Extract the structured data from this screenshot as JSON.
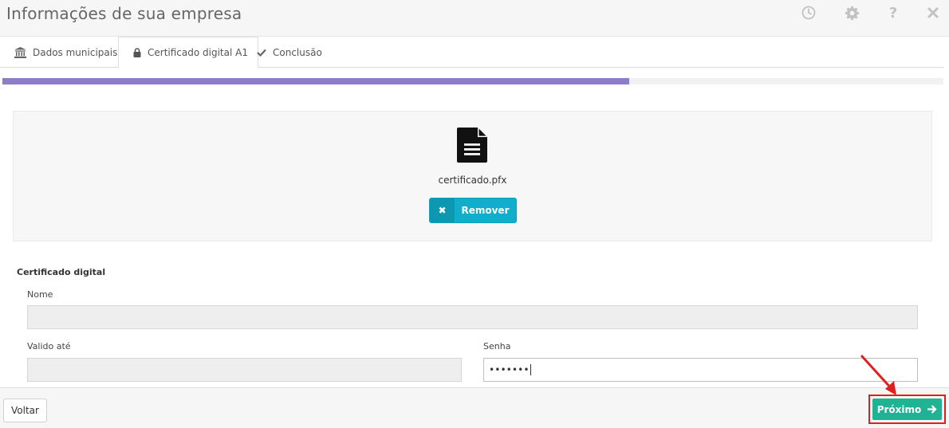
{
  "header": {
    "title": "Informações de sua empresa",
    "icons": [
      "clock-icon",
      "gear-icon",
      "help-icon",
      "close-icon"
    ]
  },
  "tabs": [
    {
      "label": "Dados municipais",
      "icon": "bank-icon",
      "active": false
    },
    {
      "label": "Certificado digital A1",
      "icon": "lock-icon",
      "active": true
    },
    {
      "label": "Conclusão",
      "icon": "check-icon",
      "active": false
    }
  ],
  "progress": {
    "fraction": 0.666
  },
  "upload": {
    "file_icon": "file-icon",
    "file_name": "certificado.pfx",
    "remove_label": "Remover"
  },
  "certificate": {
    "section_title": "Certificado digital",
    "name_label": "Nome",
    "name_value": "",
    "valid_label": "Valido até",
    "valid_value": "",
    "password_label": "Senha",
    "password_value": "•••••••"
  },
  "footer": {
    "back_label": "Voltar",
    "next_label": "Próximo"
  },
  "colors": {
    "accent_progress": "#8c7cc9",
    "remove_button": "#11aecb",
    "next_button": "#1fb394",
    "annotation": "#e01f1f"
  }
}
